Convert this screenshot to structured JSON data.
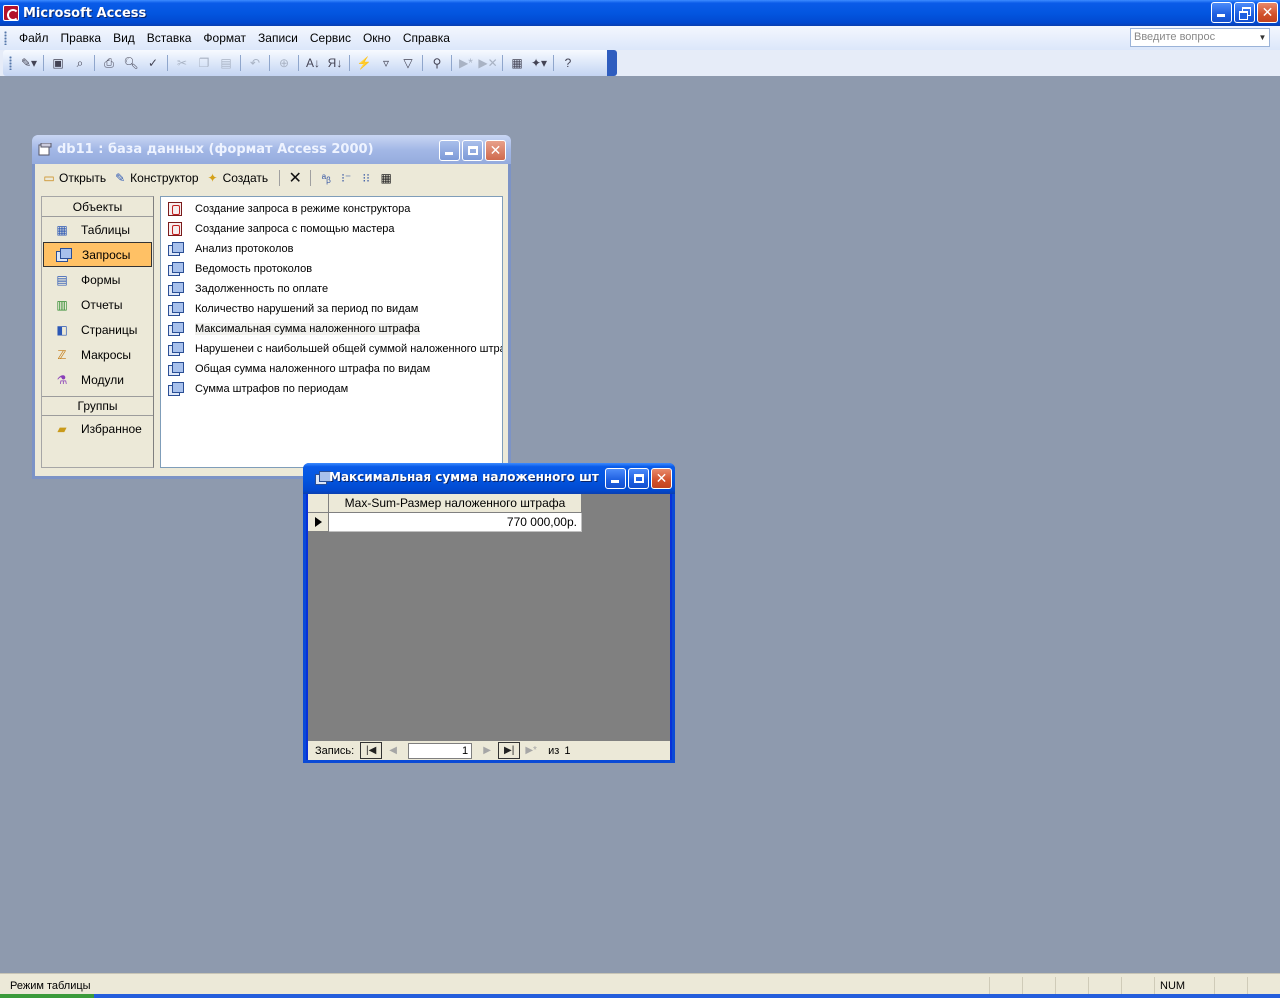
{
  "app": {
    "title": "Microsoft Access",
    "accent_color": "#0356E0"
  },
  "menubar": {
    "items": [
      "Файл",
      "Правка",
      "Вид",
      "Вставка",
      "Формат",
      "Записи",
      "Сервис",
      "Окно",
      "Справка"
    ],
    "ask_placeholder": "Введите вопрос"
  },
  "toolbar": {
    "icons": [
      "view-icon",
      "save-icon",
      "file-search-icon",
      "print-icon",
      "print-preview-icon",
      "spelling-icon",
      "cut-icon",
      "copy-icon",
      "paste-icon",
      "undo-icon",
      "hyperlink-icon",
      "sort-ascending-icon",
      "sort-descending-icon",
      "filter-by-selection-icon",
      "filter-by-form-icon",
      "apply-filter-icon",
      "find-icon",
      "new-record-icon",
      "delete-record-icon",
      "database-window-icon",
      "new-object-icon",
      "help-icon"
    ]
  },
  "db_window": {
    "title": "db11 : база данных (формат Access 2000)",
    "toolbar": {
      "open_label": "Открыть",
      "design_label": "Конструктор",
      "create_label": "Создать"
    },
    "objects_header": "Объекты",
    "objects": [
      {
        "label": "Таблицы",
        "icon": "table-icon"
      },
      {
        "label": "Запросы",
        "icon": "query-icon",
        "selected": true
      },
      {
        "label": "Формы",
        "icon": "form-icon"
      },
      {
        "label": "Отчеты",
        "icon": "report-icon"
      },
      {
        "label": "Страницы",
        "icon": "page-icon"
      },
      {
        "label": "Макросы",
        "icon": "macro-icon"
      },
      {
        "label": "Модули",
        "icon": "module-icon"
      }
    ],
    "groups_header": "Группы",
    "groups": [
      {
        "label": "Избранное",
        "icon": "favorites-folder-icon"
      }
    ],
    "items": [
      {
        "label": "Создание запроса в режиме конструктора",
        "kind": "wizard"
      },
      {
        "label": "Создание запроса с помощью мастера",
        "kind": "wizard"
      },
      {
        "label": "Анализ протоколов",
        "kind": "query"
      },
      {
        "label": "Ведомость протоколов",
        "kind": "query"
      },
      {
        "label": "Задолженность по оплате",
        "kind": "query"
      },
      {
        "label": "Количество нарушений за период по видам",
        "kind": "query"
      },
      {
        "label": "Максимальная сумма наложенного штрафа",
        "kind": "query",
        "highlighted": true
      },
      {
        "label": "Нарушенеи с наибольшей общей суммой наложенного штрафа",
        "kind": "query"
      },
      {
        "label": "Общая сумма наложенного штрафа по видам",
        "kind": "query"
      },
      {
        "label": "Сумма штрафов по периодам",
        "kind": "query"
      }
    ]
  },
  "query_window": {
    "title": "Максимальная сумма наложенного штр...",
    "column_header": "Max-Sum-Размер наложенного штрафа",
    "rows": [
      "770 000,00р."
    ],
    "nav": {
      "record_label": "Запись:",
      "current": "1",
      "of_label": "из",
      "total": "1"
    }
  },
  "statusbar": {
    "text": "Режим таблицы",
    "num": "NUM"
  }
}
